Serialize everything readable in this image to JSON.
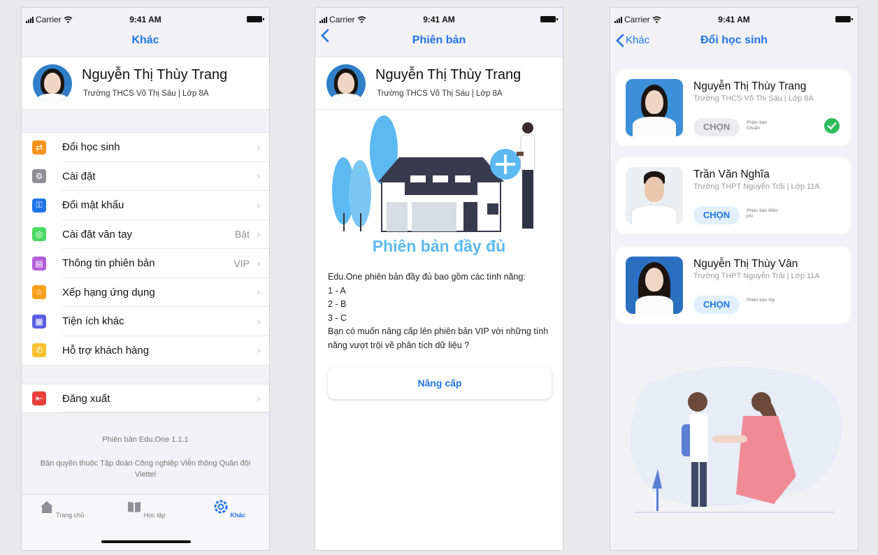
{
  "status": {
    "carrier": "Carrier",
    "time": "9:41 AM"
  },
  "profile": {
    "name": "Nguyễn Thị Thùy Trang",
    "school": "Trường THCS Võ Thị Sáu | Lớp 8A"
  },
  "screen1": {
    "title": "Khác",
    "menu": [
      {
        "label": "Đổi học sinh",
        "value": "",
        "icon": "swap-icon",
        "color": "#f7941d"
      },
      {
        "label": "Cài đặt",
        "value": "",
        "icon": "gear-icon",
        "color": "#8e8e93"
      },
      {
        "label": "Đổi mật khẩu",
        "value": "",
        "icon": "key-icon",
        "color": "#1f74e8"
      },
      {
        "label": "Cài đặt vân tay",
        "value": "Bật",
        "icon": "fingerprint-icon",
        "color": "#4cd964"
      },
      {
        "label": "Thông tin phiên bản",
        "value": "VIP",
        "icon": "version-icon",
        "color": "#b45ed9"
      },
      {
        "label": "Xếp hạng ứng dụng",
        "value": "",
        "icon": "star-icon",
        "color": "#f7a21b"
      },
      {
        "label": "Tiện ích khác",
        "value": "",
        "icon": "grid-icon",
        "color": "#5a5ee6"
      },
      {
        "label": "Hỗ trợ khách hàng",
        "value": "",
        "icon": "phone-icon",
        "color": "#fbc02d"
      }
    ],
    "logout": {
      "label": "Đăng xuất",
      "icon": "logout-icon",
      "color": "#e8403a"
    },
    "version_text": "Phiên bản Edu.One 1.1.1",
    "copyright": "Bản quyền thuộc Tập đoàn Công nghiệp Viễn thông Quân đội Viettel",
    "tabs": [
      {
        "label": "Trang chủ",
        "icon": "home-icon"
      },
      {
        "label": "Học tập",
        "icon": "book-icon"
      },
      {
        "label": "Khác",
        "icon": "settings-icon",
        "active": true
      }
    ]
  },
  "screen2": {
    "title": "Phiên bản",
    "headline": "Phiên bản đầy đủ",
    "description": [
      "Edu.One phiên bản đầy đủ bao gồm các tính năng:",
      "1 - A",
      "2 - B",
      "3 - C",
      "Bạn có muốn nâng cấp lên phiên bản VIP với những tính năng vượt trội về phân tích dữ liệu ?"
    ],
    "button": "Nâng cấp"
  },
  "screen3": {
    "back": "Khác",
    "title": "Đổi học sinh",
    "students": [
      {
        "name": "Nguyễn Thị Thùy Trang",
        "school": "Trường THCS Võ Thị Sáu | Lớp 8A",
        "button": "CHỌN",
        "plan": "Phiên bản Chuẩn",
        "selected": true
      },
      {
        "name": "Trần Văn Nghĩa",
        "school": "Trường THPT Nguyễn Trãi | Lớp 11A",
        "button": "CHỌN",
        "plan": "Phiên bản Miễn phí",
        "selected": false
      },
      {
        "name": "Nguyễn Thị Thùy Vân",
        "school": "Trường THPT Nguyễn Trãi | Lớp 11A",
        "button": "CHỌN",
        "plan": "Phiên bản Vip",
        "selected": false
      }
    ]
  },
  "colors": {
    "accent": "#1f74e8",
    "headline": "#5cb9f2",
    "success": "#2fbd5c",
    "background": "#f2f2f6"
  }
}
